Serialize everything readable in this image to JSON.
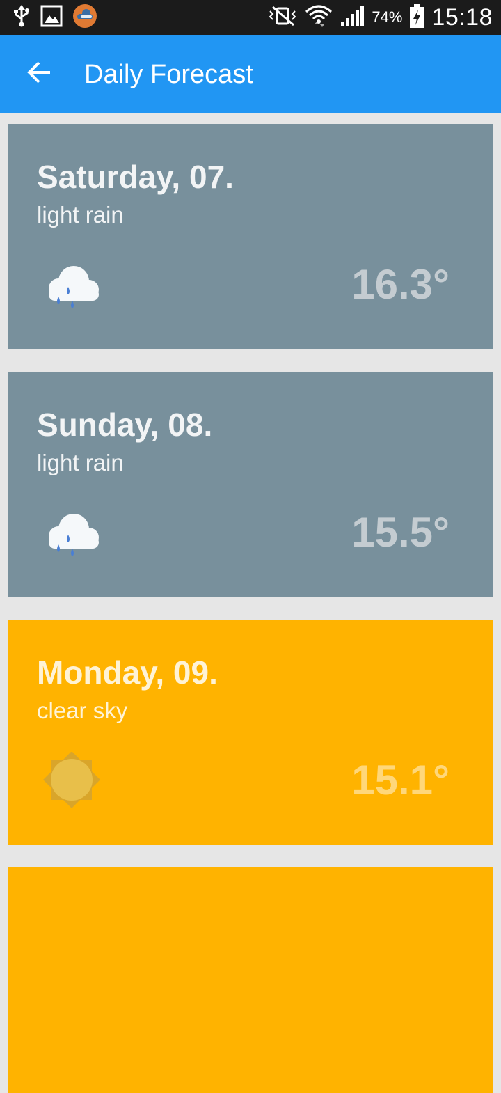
{
  "status_bar": {
    "battery_percent": "74%",
    "time": "15:18",
    "icons": [
      "usb-icon",
      "gallery-icon",
      "weather-app-icon",
      "mute-vibrate-icon",
      "wifi-icon",
      "cell-signal-icon",
      "battery-charging-icon"
    ]
  },
  "app_bar": {
    "back_icon": "arrow-left-icon",
    "title": "Daily Forecast",
    "color": "#2196f3"
  },
  "forecast": [
    {
      "day": "Saturday, 07.",
      "description": "light rain",
      "temperature": "16.3°",
      "icon": "rain-cloud-icon",
      "background": "#78909c"
    },
    {
      "day": "Sunday, 08.",
      "description": "light rain",
      "temperature": "15.5°",
      "icon": "rain-cloud-icon",
      "background": "#78909c"
    },
    {
      "day": "Monday, 09.",
      "description": "clear sky",
      "temperature": "15.1°",
      "icon": "sun-icon",
      "background": "#ffb300"
    },
    {
      "day": "",
      "description": "",
      "temperature": "",
      "icon": "",
      "background": "#ffb300"
    }
  ]
}
